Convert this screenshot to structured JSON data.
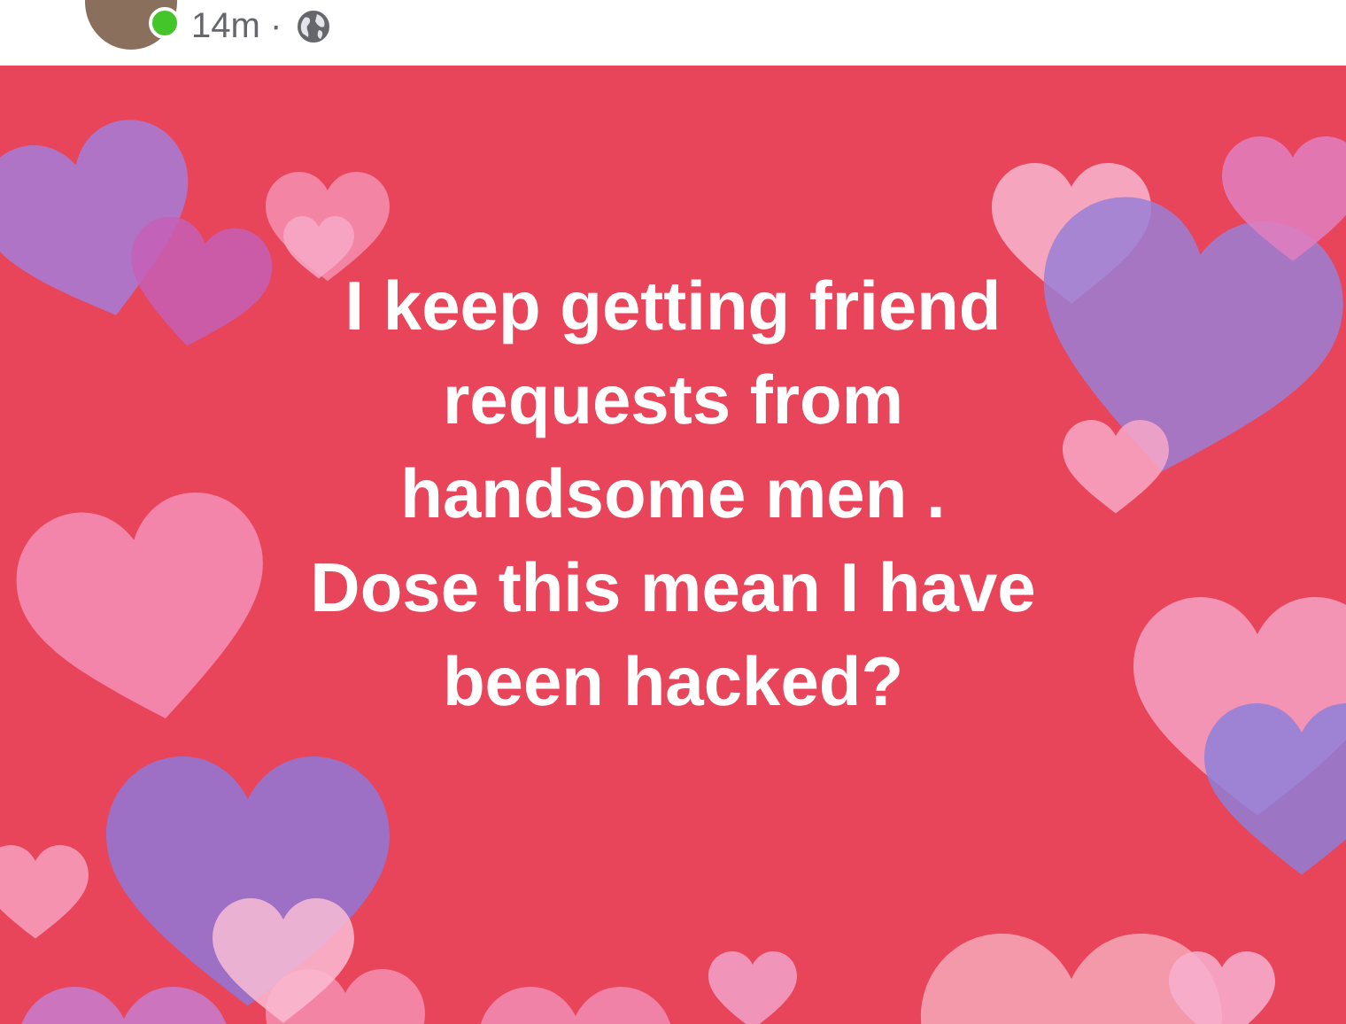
{
  "post": {
    "author": {
      "online": true
    },
    "time": "14m ·",
    "text": "I keep getting friend\nrequests from\nhandsome men .\nDose this mean I have\nbeen hacked?"
  }
}
